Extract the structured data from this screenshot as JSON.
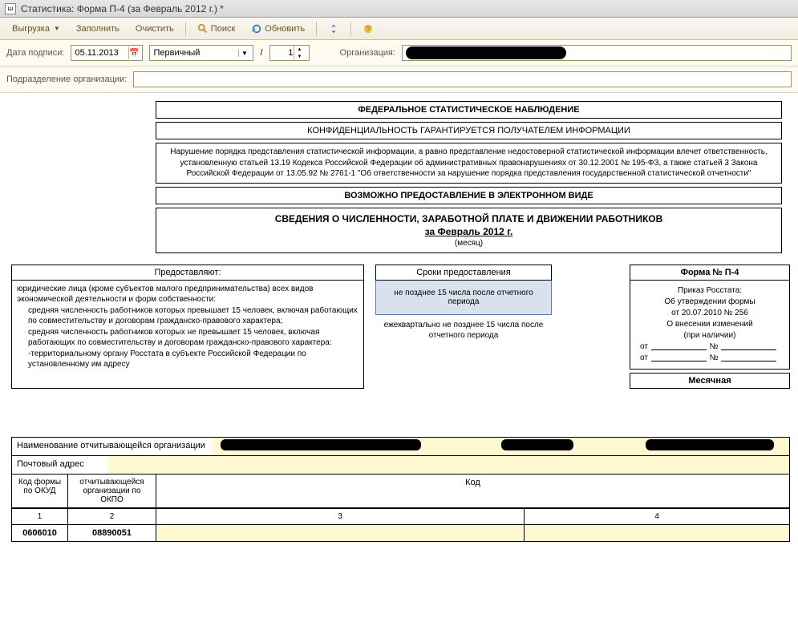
{
  "titlebar": {
    "text": "Статистика: Форма П-4 (за Февраль 2012 г.) *"
  },
  "toolbar": {
    "upload": "Выгрузка",
    "fill": "Заполнить",
    "clear": "Очистить",
    "search": "Поиск",
    "refresh": "Обновить"
  },
  "form": {
    "date_label": "Дата подписи:",
    "date_value": "05.11.2013",
    "type_value": "Первичный",
    "num_value": "1",
    "org_label": "Организация:",
    "subdiv_label": "Подразделение организации:"
  },
  "doc": {
    "header1": "ФЕДЕРАЛЬНОЕ СТАТИСТИЧЕСКОЕ НАБЛЮДЕНИЕ",
    "header2": "КОНФИДЕНЦИАЛЬНОСТЬ ГАРАНТИРУЕТСЯ ПОЛУЧАТЕЛЕМ ИНФОРМАЦИИ",
    "warning": "Нарушение порядка представления статистической информации, а равно представление недостоверной статистической информации влечет ответственность, установленную статьей 13.19 Кодекса Российской Федерации об административных правонарушениях от 30.12.2001 № 195-ФЗ, а также статьей 3 Закона Российской Федерации от 13.05.92 № 2761-1 \"Об ответственности за нарушение порядка представления государственной статистической отчетности\"",
    "electronic": "ВОЗМОЖНО ПРЕДОСТАВЛЕНИЕ В ЭЛЕКТРОННОМ ВИДЕ",
    "title1": "СВЕДЕНИЯ О ЧИСЛЕННОСТИ, ЗАРАБОТНОЙ ПЛАТЕ И ДВИЖЕНИИ РАБОТНИКОВ",
    "title2": "за Февраль 2012 г.",
    "title3": "(месяц)"
  },
  "provide": {
    "head": "Предоставляют:",
    "p1": "юридические лица (кроме субъектов малого предпринимательства) всех видов экономической деятельности и форм собственности:",
    "p2": "средняя численность работников которых превышает 15 человек, включая работающих по совместительству и договорам гражданско-правового характера;",
    "p3": "средняя численность работников которых не превышает 15 человек, включая работающих по совместительству и договорам гражданско-правового характера:",
    "p4": "-территориальному органу Росстата в субъекте Российской Федерации по установленному им адресу"
  },
  "deadline": {
    "head": "Сроки предоставления",
    "blue": "не позднее 15 числа после отчетного периода",
    "sub": "ежеквартально не позднее 15 числа после отчетного периода"
  },
  "formbox": {
    "head": "Форма № П-4",
    "l1": "Приказ Росстата:",
    "l2": "Об утверждении формы",
    "l3": "от 20.07.2010 № 256",
    "l4": "О внесении изменений",
    "l5": "(при наличии)",
    "ot": "от",
    "num": "№",
    "foot": "Месячная"
  },
  "bottom": {
    "org_label": "Наименование отчитывающейся организации",
    "addr_label": "Почтовый адрес",
    "code_label": "Код",
    "okud_label": "Код формы по ОКУД",
    "okpo_label": "отчитывающейся организации по ОКПО",
    "n1": "1",
    "n2": "2",
    "n3": "3",
    "n4": "4",
    "okud": "0606010",
    "okpo": "08890051"
  }
}
